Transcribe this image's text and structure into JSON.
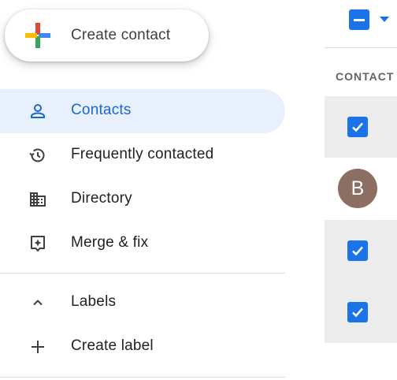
{
  "create_button": {
    "label": "Create contact",
    "icon": "multicolor-plus-icon"
  },
  "nav": {
    "items": [
      {
        "label": "Contacts",
        "icon": "person-icon",
        "active": true
      },
      {
        "label": "Frequently contacted",
        "icon": "history-icon",
        "active": false
      },
      {
        "label": "Directory",
        "icon": "building-icon",
        "active": false
      },
      {
        "label": "Merge & fix",
        "icon": "merge-fix-icon",
        "active": false
      }
    ],
    "labels_section": {
      "label": "Labels",
      "icon": "chevron-up-icon"
    },
    "create_label": {
      "label": "Create label",
      "icon": "plus-icon"
    }
  },
  "list": {
    "column_header": "CONTACT",
    "select_state": "partial",
    "rows": [
      {
        "selected": true
      },
      {
        "selected": false,
        "avatar_letter": "B",
        "avatar_color": "#8d6e63"
      },
      {
        "selected": true
      },
      {
        "selected": true
      }
    ]
  },
  "colors": {
    "accent": "#1a73e8",
    "active_bg": "#e8f0fe",
    "active_text": "#1967d2"
  }
}
